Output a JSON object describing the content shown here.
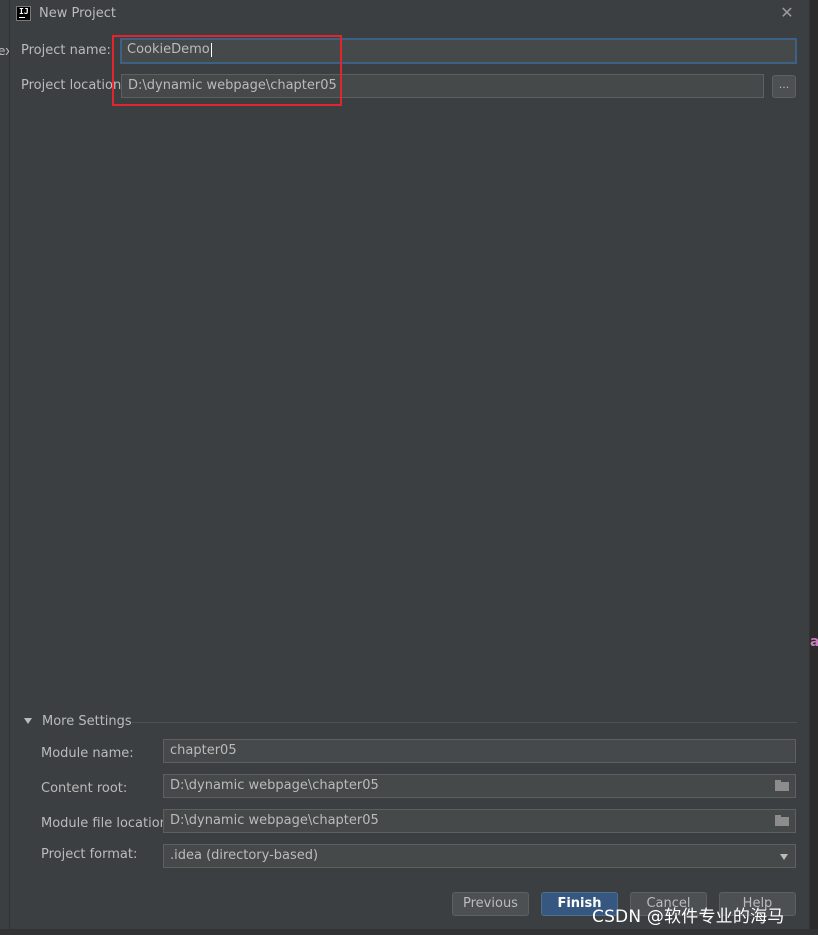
{
  "window": {
    "title": "New Project"
  },
  "background": {
    "left_fragment": "ex",
    "right_fragment": "at"
  },
  "form": {
    "project_name": {
      "label": "Project name:",
      "value": "CookieDemo"
    },
    "project_location": {
      "label": "Project location:",
      "value": "D:\\dynamic webpage\\chapter05",
      "browse_label": "..."
    }
  },
  "more_settings": {
    "label": "More Settings",
    "module_name": {
      "label": "Module name:",
      "value": "chapter05"
    },
    "content_root": {
      "label": "Content root:",
      "value": "D:\\dynamic webpage\\chapter05"
    },
    "module_file_location": {
      "label": "Module file location:",
      "value": "D:\\dynamic webpage\\chapter05"
    },
    "project_format": {
      "label": "Project format:",
      "value": ".idea (directory-based)"
    }
  },
  "buttons": {
    "previous": "Previous",
    "finish": "Finish",
    "cancel": "Cancel",
    "help": "Help"
  },
  "watermark": "CSDN @软件专业的海马",
  "colors": {
    "accent": "#365880",
    "highlight": "#e0262c",
    "background": "#3c3f41"
  }
}
